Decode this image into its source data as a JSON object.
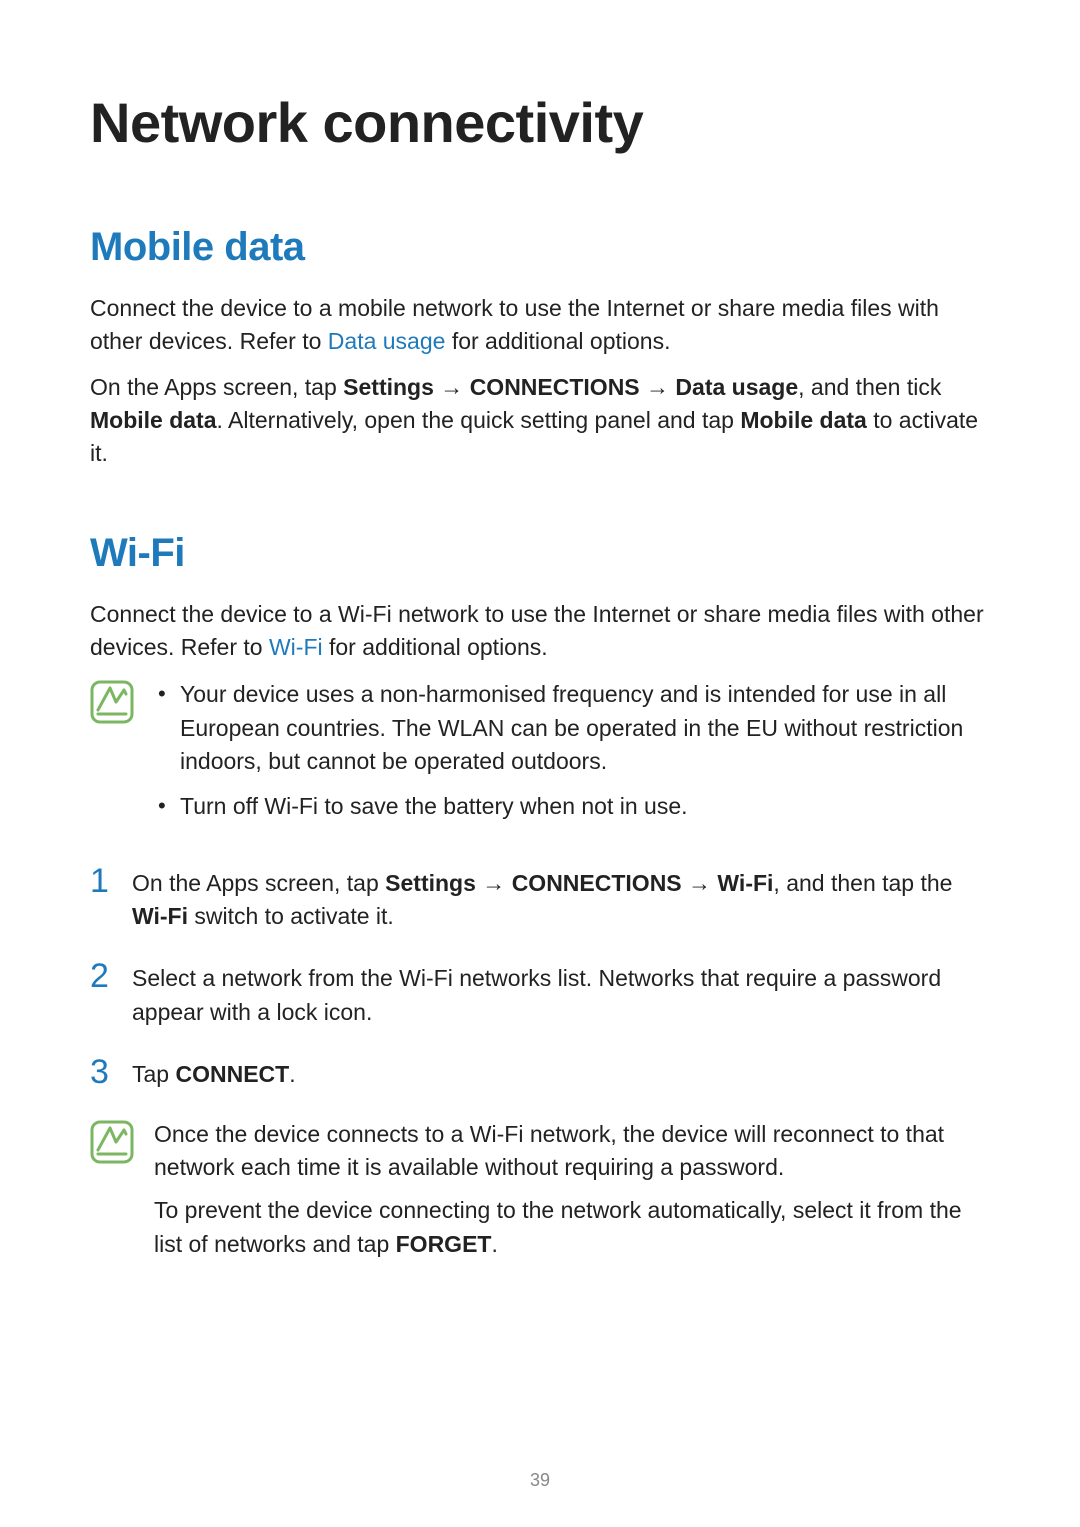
{
  "title": "Network connectivity",
  "mobile": {
    "heading": "Mobile data",
    "p1_a": "Connect the device to a mobile network to use the Internet or share media files with other devices. Refer to ",
    "p1_link": "Data usage",
    "p1_b": " for additional options.",
    "p2_a": "On the Apps screen, tap ",
    "p2_b1": "Settings",
    "p2_arrow1": " → ",
    "p2_b2": "CONNECTIONS",
    "p2_arrow2": " → ",
    "p2_b3": "Data usage",
    "p2_c": ", and then tick ",
    "p2_b4": "Mobile data",
    "p2_d": ". Alternatively, open the quick setting panel and tap ",
    "p2_b5": "Mobile data",
    "p2_e": " to activate it."
  },
  "wifi": {
    "heading": "Wi-Fi",
    "p1_a": "Connect the device to a Wi-Fi network to use the Internet or share media files with other devices. Refer to ",
    "p1_link": "Wi-Fi",
    "p1_b": " for additional options.",
    "note_li1": "Your device uses a non-harmonised frequency and is intended for use in all European countries. The WLAN can be operated in the EU without restriction indoors, but cannot be operated outdoors.",
    "note_li2": "Turn off Wi-Fi to save the battery when not in use.",
    "step1_num": "1",
    "step1_a": "On the Apps screen, tap ",
    "step1_b1": "Settings",
    "step1_ar1": " → ",
    "step1_b2": "CONNECTIONS",
    "step1_ar2": " → ",
    "step1_b3": "Wi-Fi",
    "step1_c": ", and then tap the ",
    "step1_b4": "Wi-Fi",
    "step1_d": " switch to activate it.",
    "step2_num": "2",
    "step2_text": "Select a network from the Wi-Fi networks list. Networks that require a password appear with a lock icon.",
    "step3_num": "3",
    "step3_a": "Tap ",
    "step3_b": "CONNECT",
    "step3_c": ".",
    "note2_p1": "Once the device connects to a Wi-Fi network, the device will reconnect to that network each time it is available without requiring a password.",
    "note2_p2a": "To prevent the device connecting to the network automatically, select it from the list of networks and tap ",
    "note2_p2b": "FORGET",
    "note2_p2c": "."
  },
  "page_number": "39"
}
